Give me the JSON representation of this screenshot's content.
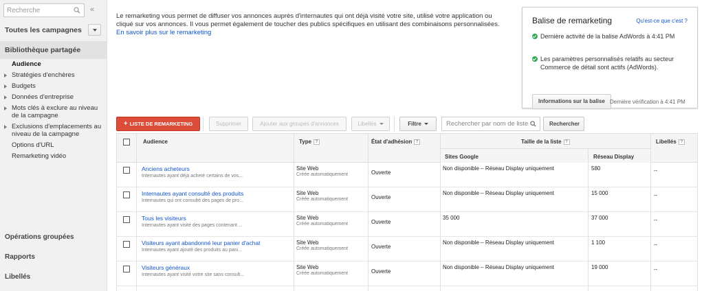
{
  "sidebar": {
    "search_placeholder": "Recherche",
    "collapse_symbol": "«",
    "all_campaigns": "Toutes les campagnes",
    "shared_library": "Bibliothèque partagée",
    "library_items": [
      {
        "label": "Audience",
        "active": true,
        "expandable": false
      },
      {
        "label": "Stratégies d'enchères",
        "active": false,
        "expandable": true
      },
      {
        "label": "Budgets",
        "active": false,
        "expandable": true
      },
      {
        "label": "Données d'entreprise",
        "active": false,
        "expandable": true
      },
      {
        "label": "Mots clés à exclure au niveau de la campagne",
        "active": false,
        "expandable": true
      },
      {
        "label": "Exclusions d'emplacements au niveau de la campagne",
        "active": false,
        "expandable": true
      },
      {
        "label": "Options d'URL",
        "active": false,
        "expandable": false
      },
      {
        "label": "Remarketing vidéo",
        "active": false,
        "expandable": false
      }
    ],
    "bulk_ops": "Opérations groupées",
    "reports": "Rapports",
    "labels": "Libellés"
  },
  "intro": {
    "text": "Le remarketing vous permet de diffuser vos annonces auprès d'internautes qui ont déjà visité votre site, utilisé votre application ou cliqué sur vos annonces. Il vous permet également de toucher des publics spécifiques en utilisant des combinaisons personnalisées. ",
    "link": "En savoir plus sur le remarketing"
  },
  "panel": {
    "title": "Balise de remarketing",
    "help_link": "Qu'est-ce que c'est ?",
    "status_1": "Dernière activité de la balise AdWords à 4:41 PM",
    "status_2": "Les paramètres personnalisés relatifs au secteur Commerce de détail sont actifs (AdWords).",
    "info_button": "Informations sur la balise",
    "last_check": "Dernière vérification à 4:41 PM"
  },
  "toolbar": {
    "add_list": "LISTE DE REMARKETING",
    "delete": "Supprimer",
    "add_to_groups": "Ajouter aux groupes d'annonces",
    "labels": "Libellés",
    "filter": "Filtre",
    "search_placeholder": "Rechercher par nom de liste",
    "search_button": "Rechercher"
  },
  "table": {
    "headers": {
      "audience": "Audience",
      "type": "Type",
      "etat": "État d'adhésion",
      "taille": "Taille de la liste",
      "sites_google": "Sites Google",
      "reseau_display": "Réseau Display",
      "libelles": "Libellés"
    },
    "help_mark": "?",
    "rows": [
      {
        "name": "Anciens acheteurs",
        "desc": "Internautes ayant déjà acheté certains de vos...",
        "type": "Site Web",
        "type_sub": "Créée automatiquement",
        "etat": "Ouverte",
        "sites": "Non disponible – Réseau Display uniquement",
        "display": "580",
        "labels": "--"
      },
      {
        "name": "Internautes ayant consulté des produits",
        "desc": "Internautes qui ont consulté des pages de pro...",
        "type": "Site Web",
        "type_sub": "Créée automatiquement",
        "etat": "Ouverte",
        "sites": "Non disponible – Réseau Display uniquement",
        "display": "15 000",
        "labels": "--"
      },
      {
        "name": "Tous les visiteurs",
        "desc": "Internautes ayant visité des pages contenant ...",
        "type": "Site Web",
        "type_sub": "Créée automatiquement",
        "etat": "Ouverte",
        "sites": "35 000",
        "display": "37 000",
        "labels": "--"
      },
      {
        "name": "Visiteurs ayant abandonné leur panier d'achat",
        "desc": "Internautes ayant ajouté des produits au pani...",
        "type": "Site Web",
        "type_sub": "Créée automatiquement",
        "etat": "Ouverte",
        "sites": "Non disponible – Réseau Display uniquement",
        "display": "1 100",
        "labels": "--"
      },
      {
        "name": "Visiteurs généraux",
        "desc": "Internautes ayant visité votre site sans consult...",
        "type": "Site Web",
        "type_sub": "Créée automatiquement",
        "etat": "Ouverte",
        "sites": "Non disponible – Réseau Display uniquement",
        "display": "19 000",
        "labels": "--"
      }
    ]
  },
  "colors": {
    "accent_red": "#dd4b39",
    "link_blue": "#1155cc",
    "check_green": "#31a854"
  }
}
